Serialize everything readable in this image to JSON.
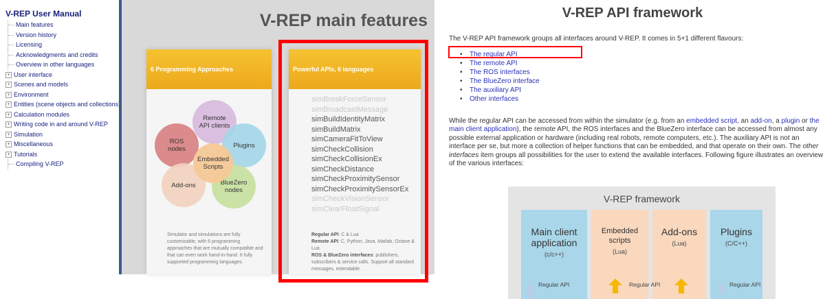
{
  "toc": {
    "title": "V-REP User Manual",
    "items": [
      {
        "label": "Main features",
        "kind": "child"
      },
      {
        "label": "Version history",
        "kind": "child"
      },
      {
        "label": "Licensing",
        "kind": "child"
      },
      {
        "label": "Acknowledgments and credits",
        "kind": "child"
      },
      {
        "label": "Overview in other languages",
        "kind": "child"
      },
      {
        "label": "User interface",
        "kind": "expand"
      },
      {
        "label": "Scenes and models",
        "kind": "expand"
      },
      {
        "label": "Environment",
        "kind": "expand"
      },
      {
        "label": "Entities (scene objects and collections)",
        "kind": "expand"
      },
      {
        "label": "Calculation modules",
        "kind": "expand"
      },
      {
        "label": "Writing code in and around V-REP",
        "kind": "expand"
      },
      {
        "label": "Simulation",
        "kind": "expand"
      },
      {
        "label": "Miscellaneous",
        "kind": "expand"
      },
      {
        "label": "Tutorials",
        "kind": "expand"
      },
      {
        "label": "Compiling V-REP",
        "kind": "child"
      }
    ]
  },
  "features": {
    "heading": "V-REP main features",
    "card1": {
      "header": "6 Programming Approaches",
      "petals": [
        "Remote API clients",
        "ROS nodes",
        "Plugins",
        "Embedded Scripts",
        "Add-ons",
        "BlueZero nodes"
      ],
      "text": "Simulator and simulations are fully customizable, with 6 programming approaches that are mutually compatible and that can even work hand-in-hand. 6 fully supported programming languages."
    },
    "card2": {
      "header": "Powerful APIs, 6 languages",
      "apis": [
        "simBreakForceSensor",
        "simBroadcastMessage",
        "simBuildIdentityMatrix",
        "simBuildMatrix",
        "simCameraFitToView",
        "simCheckCollision",
        "simCheckCollisionEx",
        "simCheckDistance",
        "simCheckProximitySensor",
        "simCheckProximitySensorEx",
        "simCheckVisionSensor",
        "simClearFloatSignal"
      ],
      "regular_label": "Regular API",
      "regular_text": ": C & Lua",
      "remote_label": "Remote API",
      "remote_text": ": C, Python, Java, Matlab, Octave & Lua",
      "ros_label": "ROS & BlueZero interfaces",
      "ros_text": ": publishers, subscribers & service calls. Support all standard messages, extendable."
    }
  },
  "framework": {
    "title": "V-REP API framework",
    "intro": "The V-REP API framework groups all interfaces around V-REP. It comes in 5+1 different flavours:",
    "list": [
      "The regular API",
      "The remote API",
      "The ROS interfaces",
      "The BlueZero interface",
      "The auxiliary API",
      "Other interfaces"
    ],
    "para": {
      "p1": "While the regular API can be accessed from within the simulator (e.g. from an ",
      "l1": "embedded script",
      "p2": ", an ",
      "l2": "add-on",
      "p3": ", a ",
      "l3": "plugin",
      "p4": " or ",
      "l4": "the main client application",
      "p5": "), the remote API, the ROS interfaces and the BlueZero interface can be accessed from almost any possible external application or hardware (including real robots, remote computers, etc.). The auxiliary API is not an interface per se, but more a collection of helper functions that can be embedded, and that operate on their own. The ",
      "em": "other interfaces",
      "p6": " item groups all possibilities for the user to extend the available interfaces. Following figure illustrates an overview of the various interfaces:"
    },
    "diagram": {
      "title": "V-REP framework",
      "blocks": [
        {
          "name": "Main client application",
          "lang": "(c/c++)"
        },
        {
          "name": "Embedded scripts",
          "lang": "(Lua)"
        },
        {
          "name": "Add-ons",
          "lang": "(Lua)"
        },
        {
          "name": "Plugins",
          "lang": "(C/C++)"
        }
      ],
      "arrow_label": "Regular API"
    }
  }
}
